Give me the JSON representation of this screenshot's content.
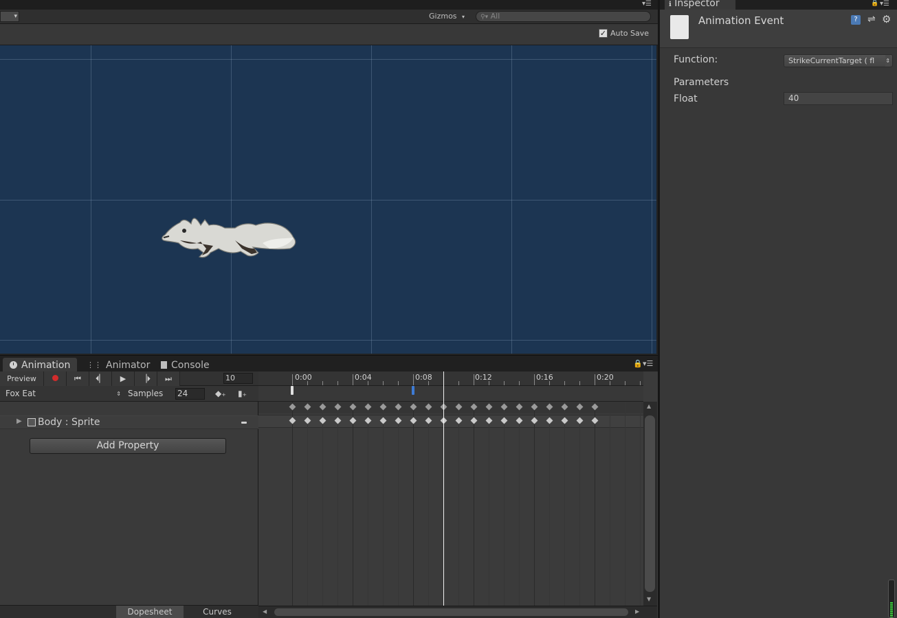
{
  "scene": {
    "gizmos_label": "Gizmos",
    "search_placeholder": "All",
    "auto_save_label": "Auto Save",
    "auto_save_checked": true,
    "viewport_bg": "#1c3552"
  },
  "animation_window": {
    "tabs": [
      {
        "label": "Animation",
        "icon": "clock-icon",
        "active": true
      },
      {
        "label": "Animator",
        "icon": "animator-icon",
        "active": false
      },
      {
        "label": "Console",
        "icon": "console-icon",
        "active": false
      }
    ],
    "toolbar": {
      "preview_label": "Preview",
      "record_color": "#d22c2c",
      "frame_value": "10"
    },
    "clip_name": "Fox Eat",
    "samples_label": "Samples",
    "samples_value": "24",
    "property": "Body : Sprite",
    "add_property_label": "Add Property",
    "view_tabs": [
      {
        "label": "Dopesheet",
        "active": true
      },
      {
        "label": "Curves",
        "active": false
      }
    ],
    "timeline": {
      "labels": [
        "0:00",
        "0:04",
        "0:08",
        "0:12",
        "0:16",
        "0:20"
      ],
      "keyframes_per_row": 21,
      "current_frame": 10,
      "event_marker_frames": [
        0,
        8
      ]
    }
  },
  "inspector": {
    "tab_label": "Inspector",
    "title": "Animation Event",
    "function_label": "Function:",
    "function_value": "StrikeCurrentTarget ( fl",
    "parameters_label": "Parameters",
    "float_label": "Float",
    "float_value": "40"
  }
}
